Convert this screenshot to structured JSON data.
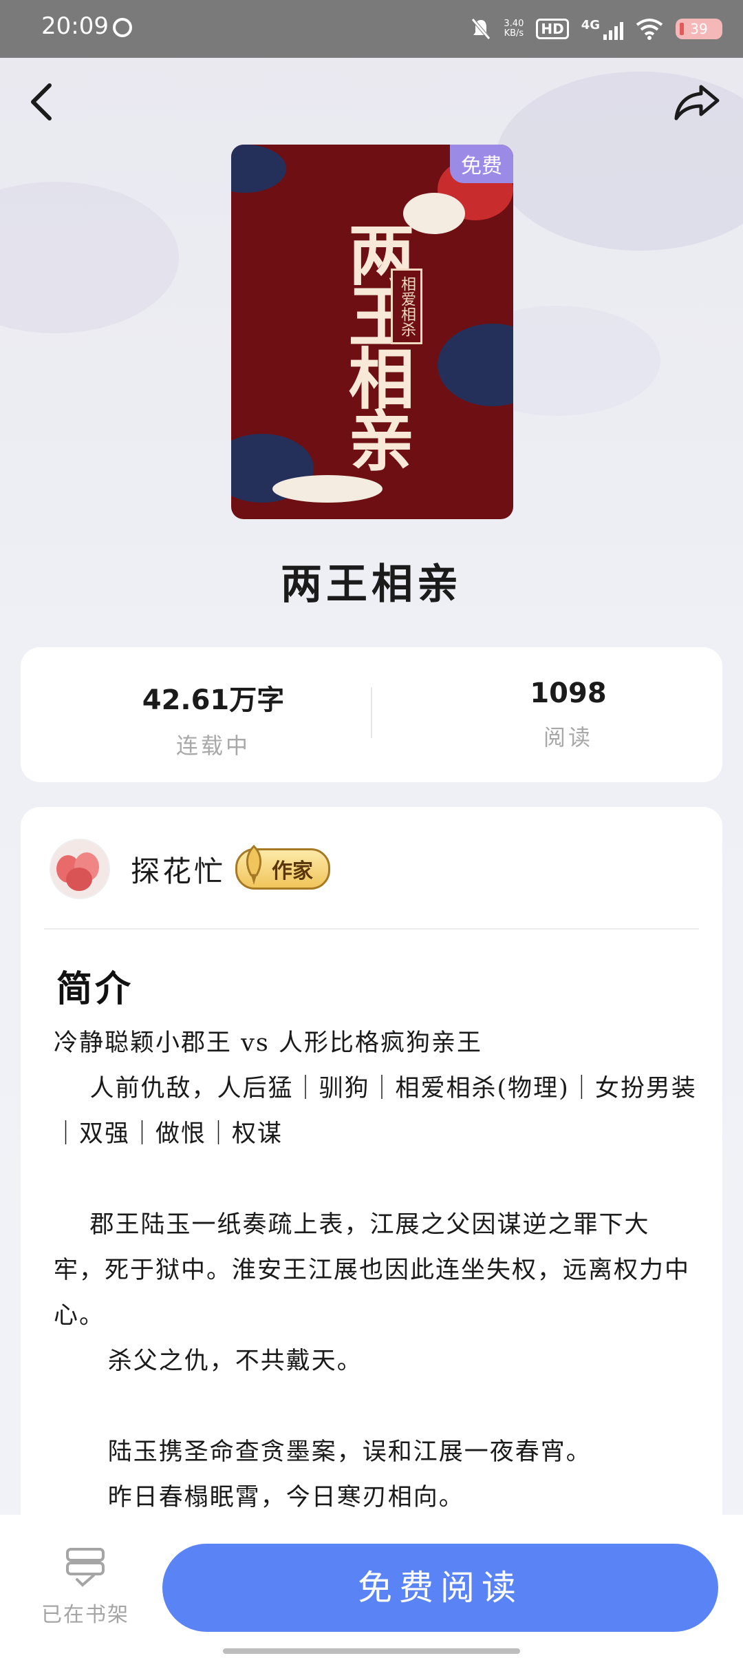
{
  "status_bar": {
    "time": "20:09",
    "net_speed": "3.40\nKB/s",
    "hd": "HD",
    "network": "4G",
    "battery": "39",
    "icons": [
      "mute-icon",
      "signal-icon",
      "wifi-icon",
      "battery-icon"
    ]
  },
  "book": {
    "free_badge": "免费",
    "cover_title": "两王相亲",
    "cover_subtitle": "相爱相杀",
    "title": "两王相亲"
  },
  "stats": {
    "words_value": "42.61万字",
    "words_label": "连载中",
    "reads_value": "1098",
    "reads_label": "阅读"
  },
  "author": {
    "name": "探花忙",
    "badge": "作家"
  },
  "intro": {
    "heading": "简介",
    "lines": [
      "冷静聪颖小郡王 vs 人形比格疯狗亲王",
      "    人前仇敌，人后猛｜驯狗｜相爱相杀(物理)｜女扮男装｜双强｜做恨｜权谋",
      "",
      "    郡王陆玉一纸奏疏上表，江展之父因谋逆之罪下大牢，死于狱中。淮安王江展也因此连坐失权，远离权力中心。",
      "      杀父之仇，不共戴天。",
      "",
      "      陆玉携圣命查贪墨案，误和江展一夜春宵。",
      "      昨日春榻眠霄，今日寒刃相向。"
    ]
  },
  "bottom": {
    "shelf_label": "已在书架",
    "read_button": "免费阅读"
  }
}
